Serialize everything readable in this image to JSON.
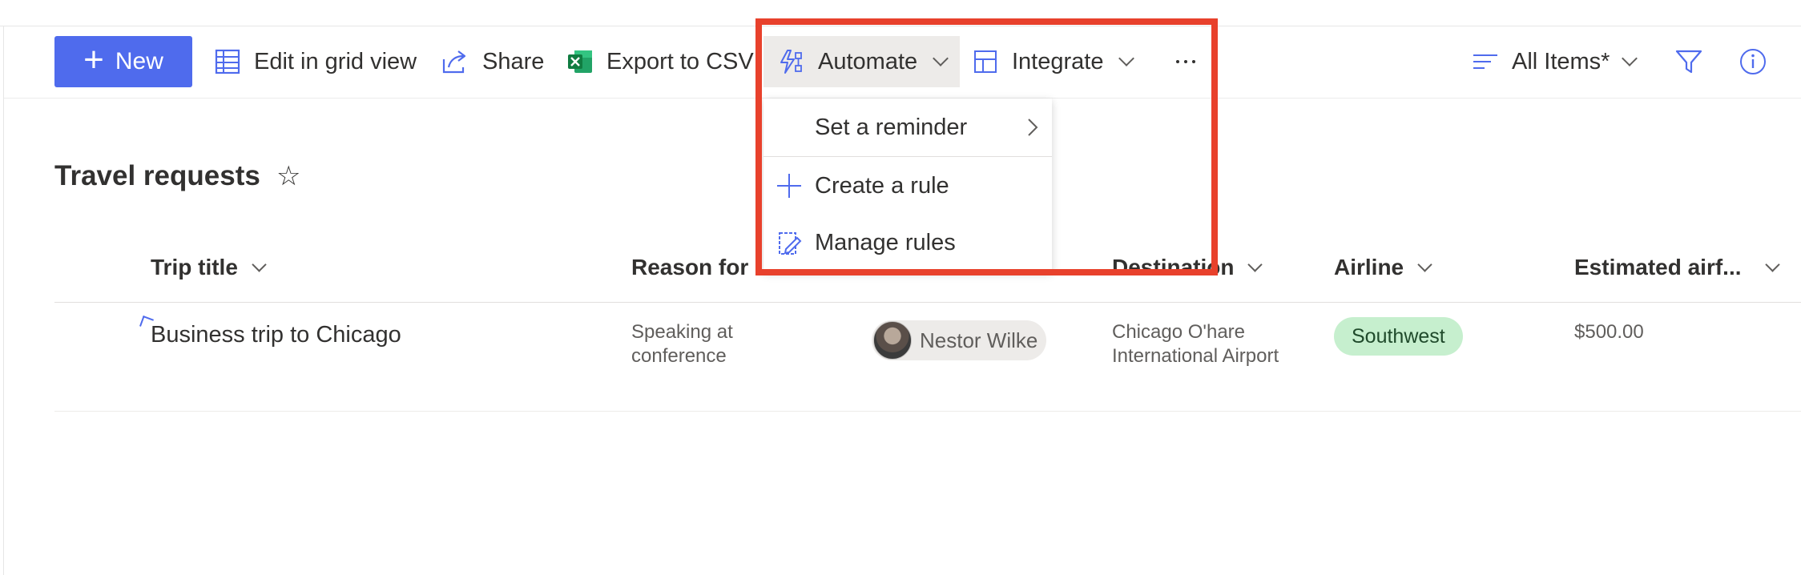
{
  "toolbar": {
    "new_label": "New",
    "edit_grid_label": "Edit in grid view",
    "share_label": "Share",
    "export_label": "Export to CSV",
    "automate_label": "Automate",
    "integrate_label": "Integrate",
    "view_label": "All Items*"
  },
  "automate_menu": {
    "items": [
      {
        "label": "Set a reminder"
      },
      {
        "label": "Create a rule"
      },
      {
        "label": "Manage rules"
      }
    ]
  },
  "list": {
    "title": "Travel requests",
    "columns": [
      {
        "label": "Trip title"
      },
      {
        "label": "Reason for"
      },
      {
        "label": "Destination"
      },
      {
        "label": "Airline"
      },
      {
        "label": "Estimated airf..."
      }
    ],
    "rows": [
      {
        "trip_title": "Business trip to Chicago",
        "reason_line1": "Speaking at",
        "reason_line2": "conference",
        "traveler": "Nestor Wilke",
        "destination_line1": "Chicago O'hare",
        "destination_line2": "International Airport",
        "airline": "Southwest",
        "estimated_airfare": "$500.00"
      }
    ]
  },
  "colors": {
    "accent": "#4f6bed",
    "highlight_box": "#e8412c",
    "airline_pill": "#c6efce",
    "excel_green": "#1d6f42"
  },
  "icons": {
    "new": "plus-icon",
    "edit_grid": "grid-icon",
    "share": "share-icon",
    "export": "excel-icon",
    "automate": "automate-icon",
    "integrate": "integrate-icon",
    "more": "more-icon",
    "view": "list-view-icon",
    "filter": "filter-icon",
    "info": "info-icon",
    "favorite": "star-icon"
  }
}
